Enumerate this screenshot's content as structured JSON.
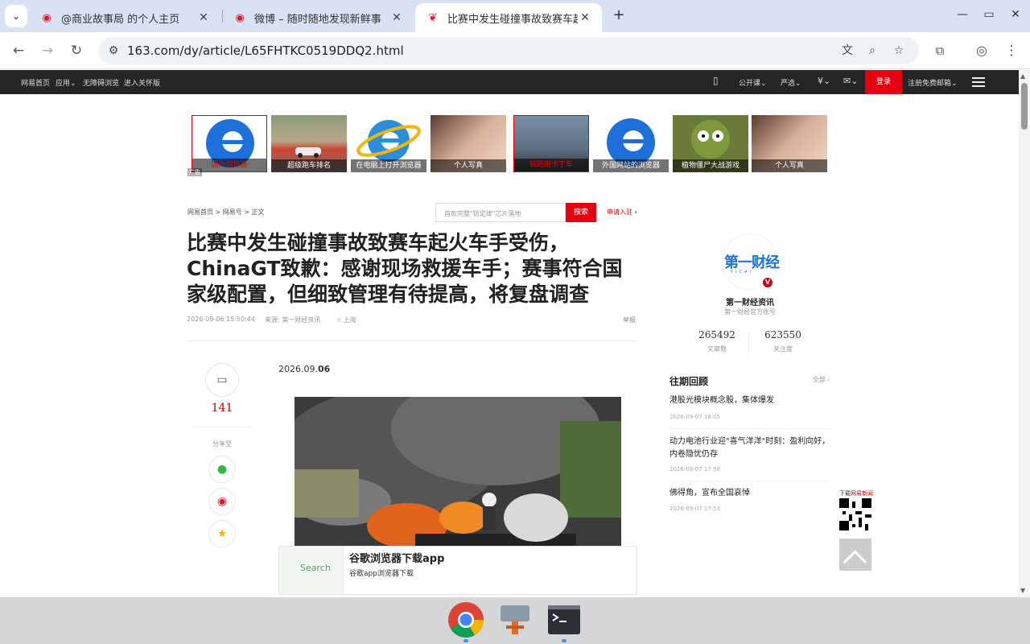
{
  "browser": {
    "tabs": [
      {
        "title": "@商业故事局 的个人主页",
        "close": "✕"
      },
      {
        "title": "微博 – 随时随地发现新鲜事",
        "close": "✕"
      },
      {
        "title": "比赛中发生碰撞事故致赛车起",
        "close": "✕"
      }
    ],
    "new_tab": "+",
    "url": "163.com/dy/article/L65FHTKC0519DDQ2.html"
  },
  "site_nav": {
    "left": [
      "网易首页",
      "应用",
      "无障碍浏览",
      "进入关怀版"
    ],
    "right": [
      "公开课",
      "严选",
      "登录",
      "注册免费邮箱"
    ]
  },
  "ads": [
    {
      "caption": "国外浏览器"
    },
    {
      "caption": "超级跑车排名"
    },
    {
      "caption": "在电脑上打开浏览器"
    },
    {
      "caption": "个人写真"
    },
    {
      "caption": "玩跑跑卡丁车"
    },
    {
      "caption": "外国网站的浏览器"
    },
    {
      "caption": "植物僵尸大战游戏"
    },
    {
      "caption": "个人写真"
    }
  ],
  "ad_tag": "广告",
  "breadcrumb": "网易首页 > 网易号 > 正文",
  "search": {
    "placeholder": "首款完整\"铠定律\"芯片落地",
    "button": "搜索"
  },
  "apply_link": "申请入驻 ›",
  "article": {
    "title": "比赛中发生碰撞事故致赛车起火车手受伤，ChinaGT致歉：感谢现场救援车手；赛事符合国家级配置，但细致管理有待提高，将复盘调查",
    "datetime": "2026-09-06 15:50:44",
    "source": "来源: 第一财经资讯",
    "location": "上海",
    "report": "举报",
    "date_prefix": "2026.09.",
    "date_day": "06"
  },
  "tools": {
    "comment_count": "141",
    "share_label": "分享至"
  },
  "bottom_ad": {
    "thumb_text": "Search",
    "title": "谷歌浏览器下载app",
    "subtitle": "谷歌app浏览器下载"
  },
  "account": {
    "logo_text": "第一财经",
    "logo_sub": "YICAI",
    "name": "第一财经资讯",
    "desc": "第一财经官方账号",
    "articles": "265492",
    "articles_label": "文章数",
    "follows": "623550",
    "follows_label": "关注度"
  },
  "past": {
    "heading": "往期回顾",
    "all": "全部 ›",
    "items": [
      {
        "title": "港股光模块概念股，集体爆发",
        "date": "2026-09-07 18:05"
      },
      {
        "title": "动力电池行业迎\"喜气洋洋\"时刻：盈利向好，内卷隐忧仍存",
        "date": "2026-09-07 17:58"
      },
      {
        "title": "佛得角，宣布全国哀悼",
        "date": "2026-09-07 17:53"
      }
    ]
  },
  "qr_label_prefix": "下载",
  "qr_label_red": "网易新闻",
  "colors": {
    "accent": "#e50012",
    "nav_bg": "#252525",
    "tabstrip": "#d8e2f2"
  }
}
